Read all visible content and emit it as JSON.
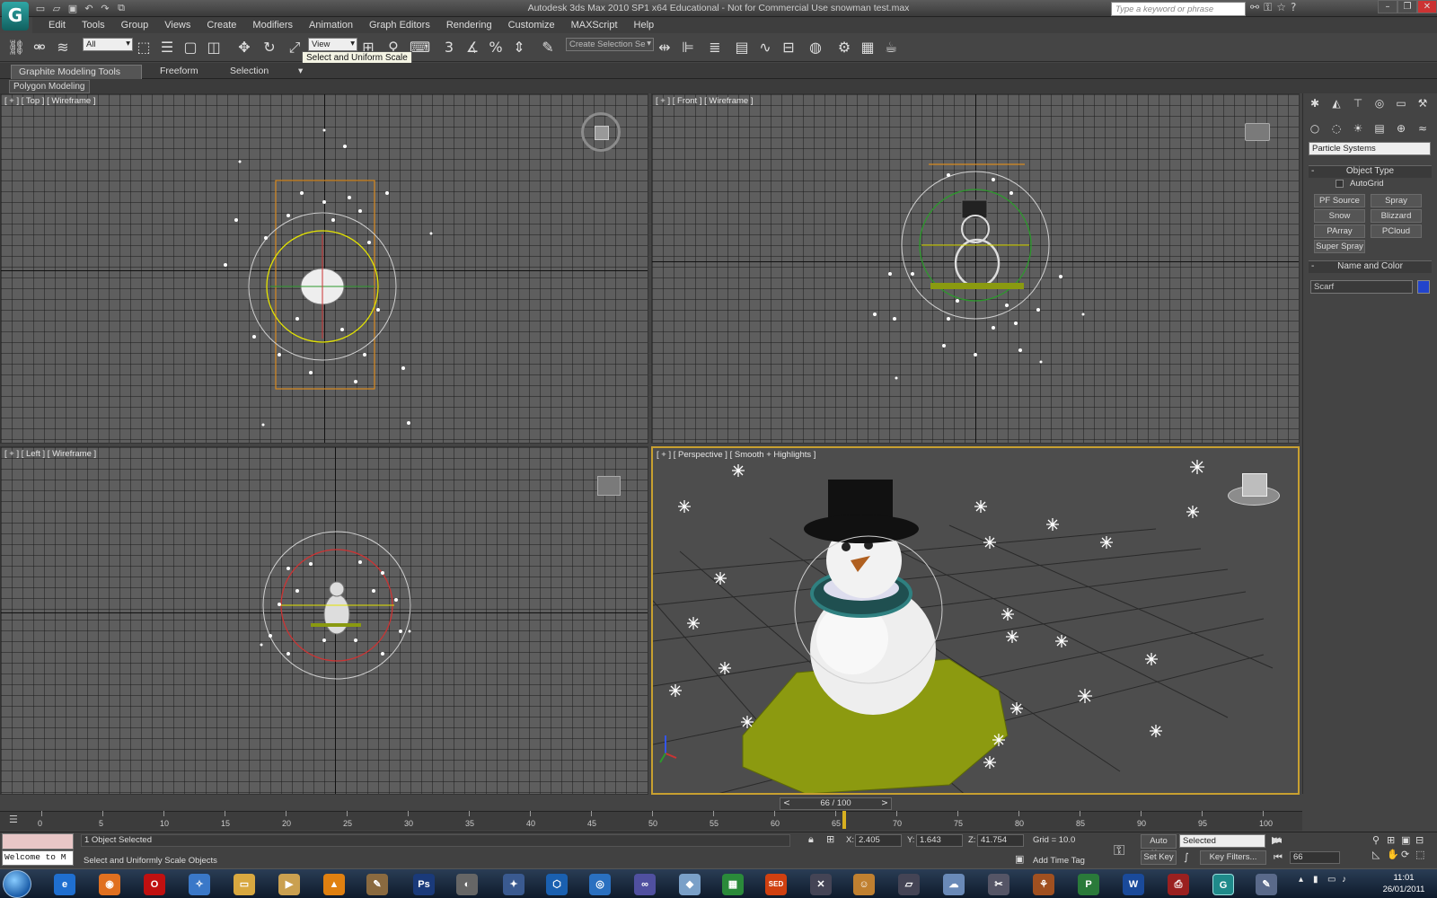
{
  "window": {
    "title": "Autodesk 3ds Max  2010 SP1 x64   Educational - Not for Commercial Use      snowman test.max",
    "search_placeholder": "Type a keyword or phrase"
  },
  "app_logo": "G",
  "menu": [
    "Edit",
    "Tools",
    "Group",
    "Views",
    "Create",
    "Modifiers",
    "Animation",
    "Graph Editors",
    "Rendering",
    "Customize",
    "MAXScript",
    "Help"
  ],
  "toolbar": {
    "filter_value": "All",
    "ref_coord_value": "View",
    "named_selection_value": "Create Selection Se",
    "tooltip": "Select and Uniform Scale",
    "snap_label": "3"
  },
  "ribbon": {
    "tabs": [
      "Graphite Modeling Tools",
      "Freeform",
      "Selection"
    ],
    "panel_label": "Polygon Modeling"
  },
  "viewports": {
    "top": "[ + ] [ Top ] [ Wireframe ]",
    "front": "[ + ] [ Front ] [ Wireframe ]",
    "left": "[ + ] [ Left ] [ Wireframe ]",
    "perspective": "[ + ] [ Perspective ] [ Smooth + Highlights ]"
  },
  "command_panel": {
    "category_value": "Particle Systems",
    "object_type_title": "Object Type",
    "autogrid_label": "AutoGrid",
    "buttons": [
      "PF Source",
      "Spray",
      "Snow",
      "Blizzard",
      "PArray",
      "PCloud",
      "Super Spray"
    ],
    "name_color_title": "Name and Color",
    "object_name": "Scarf",
    "object_color": "#2244cc"
  },
  "timeline": {
    "slider_value": "66 / 100",
    "tick_labels": [
      "0",
      "5",
      "10",
      "15",
      "20",
      "25",
      "30",
      "35",
      "40",
      "45",
      "50",
      "55",
      "60",
      "65",
      "70",
      "75",
      "80",
      "85",
      "90",
      "95",
      "100"
    ]
  },
  "status": {
    "welcome_text": "Welcome to M",
    "selection_info": "1 Object Selected",
    "prompt": "Select and Uniformly Scale Objects",
    "x_label": "X:",
    "x_value": "2.405",
    "y_label": "Y:",
    "y_value": "1.643",
    "z_label": "Z:",
    "z_value": "41.754",
    "grid": "Grid = 10.0",
    "add_time_tag": "Add Time Tag",
    "auto_key": "Auto Key",
    "set_key": "Set Key",
    "selected_value": "Selected",
    "key_filters": "Key Filters...",
    "frame_value": "66"
  },
  "taskbar": {
    "clock_time": "11:01",
    "clock_date": "26/01/2011",
    "app_labels": [
      "Ps",
      "SED",
      "W"
    ]
  }
}
